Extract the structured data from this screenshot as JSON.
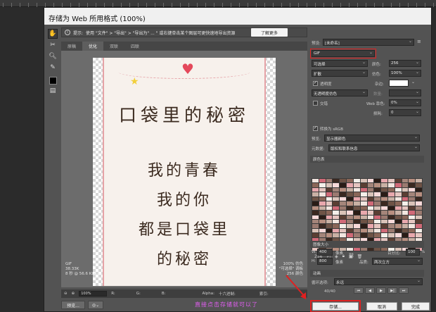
{
  "window": {
    "title": "存储为 Web 所用格式 (100%)"
  },
  "hint": {
    "label": "提示:",
    "text": "使用 \"文件\" > \"导出\" > \"导出为\" ... \" 或右键单击某个图层可更快速地导出资源",
    "learn_more": "了解更多"
  },
  "tabs": [
    {
      "label": "原稿",
      "active": false
    },
    {
      "label": "优化",
      "active": true
    },
    {
      "label": "双联",
      "active": false
    },
    {
      "label": "四联",
      "active": false
    }
  ],
  "artwork": {
    "line1": "口袋里的秘密",
    "line2": "我的青春",
    "line3": "我的你",
    "line4": "都是口袋里",
    "line5": "的秘密"
  },
  "preview_info": {
    "format": "GIF",
    "size": "38.33K",
    "time": "8 秒 @ 56.6 Kbps",
    "quality": "100% 仿色",
    "palette": "\"可选择\" 调板",
    "colors": "256 颜色"
  },
  "status": {
    "zoom": "100%",
    "r": "R:",
    "g": "G:",
    "b": "B:",
    "alpha": "Alpha:",
    "hex": "十六进制:",
    "index": "索引:"
  },
  "buttons": {
    "preview": "预览...",
    "save": "存储...",
    "cancel": "取消",
    "done": "完成"
  },
  "annotation": "直接点击存储就可以了",
  "settings": {
    "preset_label": "预设:",
    "preset_value": "[未命名]",
    "format": "GIF",
    "reduction": "可选择",
    "colors_label": "颜色:",
    "colors_value": "256",
    "dither_algo": "扩散",
    "dither_label": "仿色:",
    "dither_value": "100%",
    "transparency": "透明度",
    "matte_label": "杂边:",
    "transparency_dither": "无透明度仿色",
    "amount_label": "数量:",
    "interlaced": "交错",
    "web_snap_label": "Web 靠色:",
    "web_snap_value": "0%",
    "lossy_label": "损耗:",
    "lossy_value": "0",
    "convert_srgb": "转换为 sRGB",
    "preview_label": "预览:",
    "preview_value": "显示器颜色",
    "metadata_label": "元数据:",
    "metadata_value": "版权和联系信息"
  },
  "color_table": {
    "title": "颜色表",
    "count": "256"
  },
  "image_size": {
    "title": "图像大小",
    "w_label": "W:",
    "w_value": "400",
    "h_label": "H:",
    "h_value": "800",
    "unit": "像素",
    "percent_label": "百分比:",
    "percent_value": "100",
    "percent_unit": "%",
    "quality_label": "品质:",
    "quality_value": "两次立方"
  },
  "animation": {
    "title": "动画",
    "loop_label": "循环选项:",
    "loop_value": "永远",
    "frame": "40/40"
  },
  "colors": {
    "accent_red": "#e02020",
    "annotation": "#e05ef0"
  }
}
